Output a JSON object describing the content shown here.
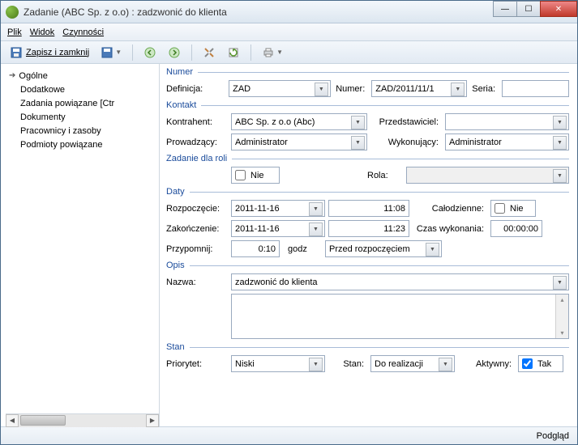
{
  "window": {
    "title": "Zadanie (ABC Sp. z o.o) : zadzwonić do klienta"
  },
  "menu": {
    "plik": "Plik",
    "widok": "Widok",
    "czynnosci": "Czynności"
  },
  "toolbar": {
    "save_label": "Zapisz i zamknij"
  },
  "sidebar": {
    "items": [
      "Ogólne",
      "Dodatkowe",
      "Zadania powiązane [Ctr",
      "Dokumenty",
      "Pracownicy i zasoby",
      "Podmioty powiązane"
    ]
  },
  "groups": {
    "numer": "Numer",
    "kontakt": "Kontakt",
    "zadanie_dla_roli": "Zadanie dla roli",
    "daty": "Daty",
    "opis": "Opis",
    "stan": "Stan"
  },
  "labels": {
    "definicja": "Definicja:",
    "numer": "Numer:",
    "seria": "Seria:",
    "kontrahent": "Kontrahent:",
    "przedstawiciel": "Przedstawiciel:",
    "prowadzacy": "Prowadzący:",
    "wykonujacy": "Wykonujący:",
    "rola": "Rola:",
    "rozpoczecie": "Rozpoczęcie:",
    "calodzienne": "Całodzienne:",
    "zakonczenie": "Zakończenie:",
    "czas_wykonania": "Czas wykonania:",
    "przypomnij": "Przypomnij:",
    "godz": "godz",
    "nazwa": "Nazwa:",
    "priorytet": "Priorytet:",
    "stan_l": "Stan:",
    "aktywny": "Aktywny:"
  },
  "values": {
    "definicja": "ZAD",
    "numer": "ZAD/2011/11/1",
    "seria": "",
    "kontrahent": "ABC Sp. z o.o (Abc)",
    "przedstawiciel": "",
    "prowadzacy": "Administrator",
    "wykonujacy": "Administrator",
    "zadanie_dla_roli_check": "Nie",
    "rola": "",
    "rozpoczecie_data": "2011-11-16",
    "rozpoczecie_czas": "11:08",
    "calodzienne_check": "Nie",
    "zakonczenie_data": "2011-11-16",
    "zakonczenie_czas": "11:23",
    "czas_wykonania": "00:00:00",
    "przypomnij": "0:10",
    "przypomnij_typ": "Przed rozpoczęciem",
    "nazwa": "zadzwonić do klienta",
    "opis": "",
    "priorytet": "Niski",
    "stan": "Do realizacji",
    "aktywny_check": "Tak"
  },
  "statusbar": {
    "podglad": "Podgląd"
  }
}
